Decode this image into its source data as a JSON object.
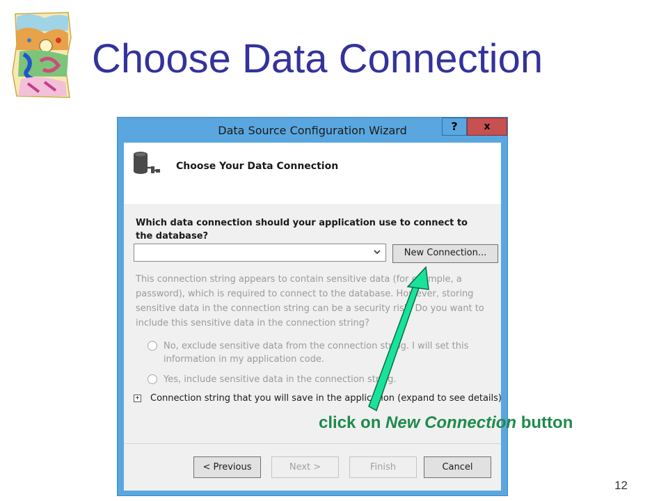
{
  "slide": {
    "title": "Choose Data Connection",
    "page_number": "12",
    "annotation": {
      "prefix": "click on ",
      "emphasis": "New Connection",
      "suffix": " button"
    }
  },
  "dialog": {
    "title": "Data Source Configuration Wizard",
    "help_label": "?",
    "close_label": "x",
    "header": {
      "title": "Choose Your Data Connection",
      "icon": "database-icon"
    },
    "question": "Which data connection should your application use to connect to the database?",
    "connection_select": {
      "value": "",
      "icon": "chevron-down-icon"
    },
    "new_connection_label": "New Connection...",
    "sensitive_text": "This connection string appears to contain sensitive data (for example, a password), which is required to connect to the database. However, storing sensitive data in the connection string can be a security risk. Do you want to include this sensitive data in the connection string?",
    "radio_options": [
      {
        "label": "No, exclude sensitive data from the connection string. I will set this information in my application code.",
        "selected": false
      },
      {
        "label": "Yes, include sensitive data in the connection string.",
        "selected": false
      }
    ],
    "expand": {
      "icon_label": "+",
      "label": "Connection string that you will save in the application (expand to see details)"
    },
    "footer_buttons": [
      {
        "label": "< Previous",
        "enabled": true
      },
      {
        "label": "Next >",
        "enabled": false
      },
      {
        "label": "Finish",
        "enabled": false
      },
      {
        "label": "Cancel",
        "enabled": true
      }
    ]
  },
  "colors": {
    "title": "#33339a",
    "annotation": "#1e8a4c",
    "arrow": "#19e39a",
    "dialog_frame": "#5aa7e0",
    "close_button": "#c75050"
  }
}
